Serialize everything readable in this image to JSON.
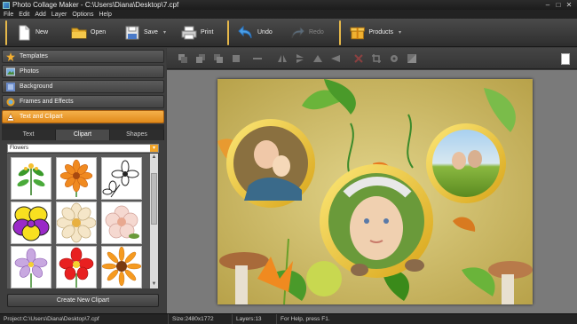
{
  "window": {
    "title": "Photo Collage Maker - C:\\Users\\Diana\\Desktop\\7.cpf",
    "minimize": "–",
    "maximize": "□",
    "close": "✕"
  },
  "menu": [
    "File",
    "Edit",
    "Add",
    "Layer",
    "Options",
    "Help"
  ],
  "toolbar": {
    "new_label": "New",
    "open_label": "Open",
    "save_label": "Save",
    "print_label": "Print",
    "undo_label": "Undo",
    "redo_label": "Redo",
    "products_label": "Products"
  },
  "sidebar": {
    "items": [
      {
        "label": "Templates",
        "icon": "star-icon"
      },
      {
        "label": "Photos",
        "icon": "photo-icon"
      },
      {
        "label": "Background",
        "icon": "background-icon"
      },
      {
        "label": "Frames and Effects",
        "icon": "frames-icon"
      },
      {
        "label": "Text and Clipart",
        "icon": "clipart-icon"
      }
    ],
    "active_index": 4
  },
  "clipart": {
    "tabs": [
      "Text",
      "Clipart",
      "Shapes"
    ],
    "active_tab": "Clipart",
    "category": "Flowers",
    "items": [
      "green-leaf-sprig",
      "orange-flower",
      "white-flower-outline",
      "yellow-purple-pansy",
      "cream-flower",
      "pink-flower",
      "purple-flower",
      "red-flower",
      "orange-sunflower"
    ],
    "create_button": "Create New Clipart"
  },
  "status": {
    "project": "Project:C:\\Users\\Diana\\Desktop\\7.cpf",
    "size": "Size:2480x1772",
    "layers": "Layers:13",
    "help": "For Help, press F1."
  },
  "colors": {
    "accent": "#f0a030",
    "separator": "#e6b84a",
    "background": "#3a3a3a"
  }
}
